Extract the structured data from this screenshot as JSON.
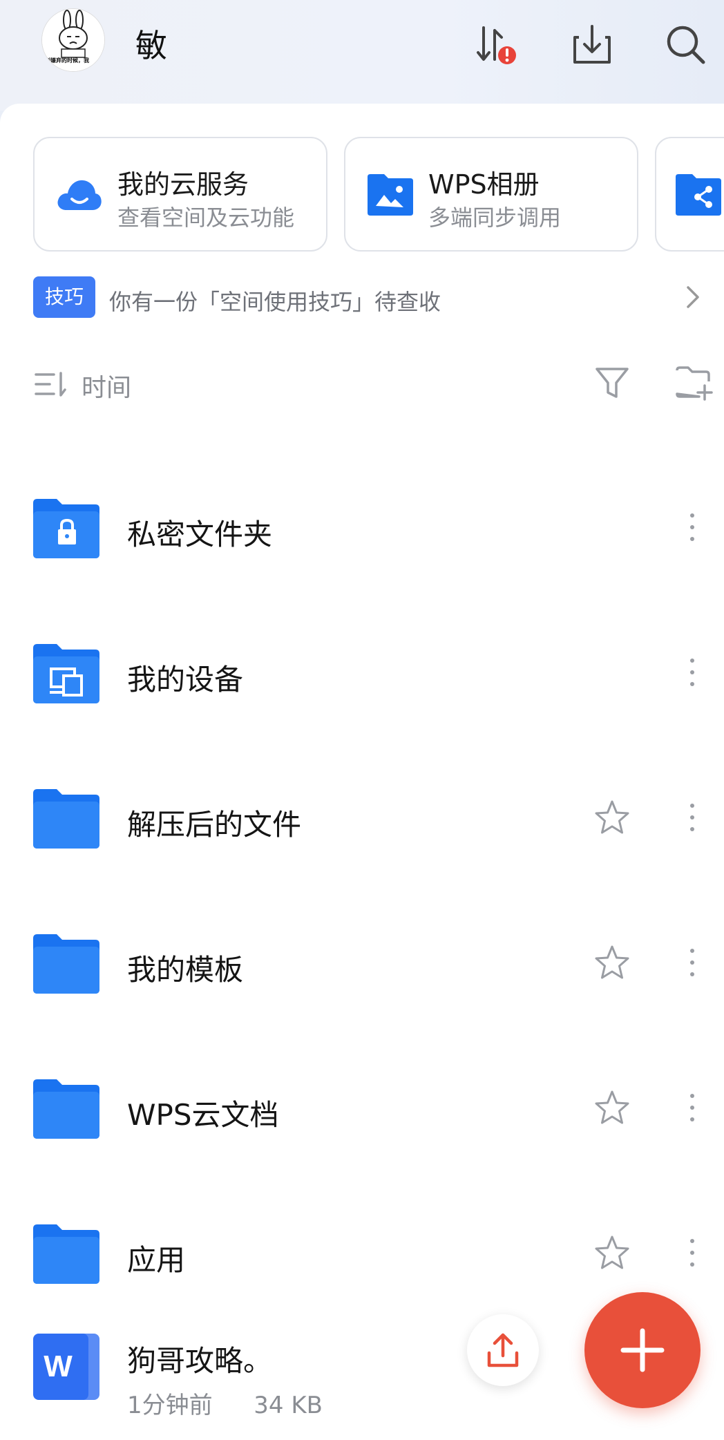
{
  "header": {
    "user_name": "敏",
    "avatar_caption": "别嫌弃的时候，我"
  },
  "services": [
    {
      "title": "我的云服务",
      "subtitle": "查看空间及云功能"
    },
    {
      "title": "WPS相册",
      "subtitle": "多端同步调用"
    }
  ],
  "tip": {
    "badge": "技巧",
    "text": "你有一份「空间使用技巧」待查收"
  },
  "sort": {
    "label": "时间"
  },
  "folders": [
    {
      "name": "私密文件夹",
      "icon": "lock-folder-icon",
      "starrable": false
    },
    {
      "name": "我的设备",
      "icon": "device-folder-icon",
      "starrable": false
    },
    {
      "name": "解压后的文件",
      "icon": "folder-icon",
      "starrable": true
    },
    {
      "name": "我的模板",
      "icon": "folder-icon",
      "starrable": true
    },
    {
      "name": "WPS云文档",
      "icon": "folder-icon",
      "starrable": true
    },
    {
      "name": "应用",
      "icon": "folder-icon",
      "starrable": true
    }
  ],
  "document": {
    "name": "狗哥攻略。",
    "time": "1分钟前",
    "size": "34 KB",
    "type_letter": "W"
  },
  "colors": {
    "accent_blue": "#1a73f0",
    "fab_red": "#e8503a",
    "alert_red": "#e8433a"
  }
}
